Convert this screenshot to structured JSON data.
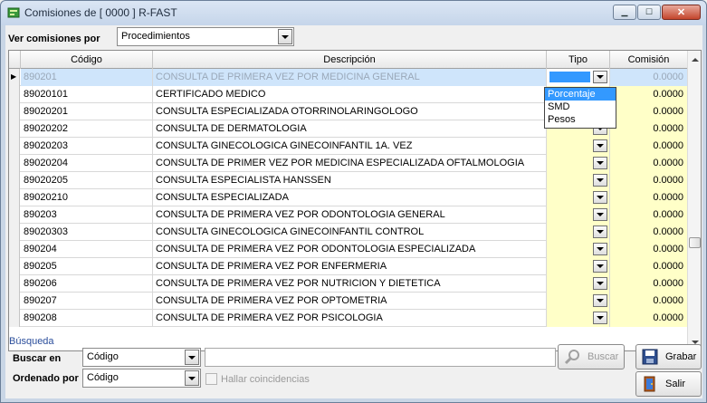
{
  "window": {
    "title": "Comisiones de [ 0000 ] R-FAST"
  },
  "filter": {
    "label": "Ver comisiones por",
    "value": "Procedimientos"
  },
  "grid": {
    "columns": {
      "codigo": "Código",
      "descripcion": "Descripción",
      "tipo": "Tipo",
      "comision": "Comisión"
    },
    "rows": [
      {
        "codigo": "890201",
        "descripcion": "CONSULTA DE PRIMERA VEZ POR MEDICINA GENERAL",
        "comision": "0.0000"
      },
      {
        "codigo": "89020101",
        "descripcion": "CERTIFICADO MEDICO",
        "comision": "0.0000"
      },
      {
        "codigo": "89020201",
        "descripcion": "CONSULTA ESPECIALIZADA OTORRINOLARINGOLOGO",
        "comision": "0.0000"
      },
      {
        "codigo": "89020202",
        "descripcion": "CONSULTA DE DERMATOLOGIA",
        "comision": "0.0000"
      },
      {
        "codigo": "89020203",
        "descripcion": "CONSULTA GINECOLOGICA  GINECOINFANTIL 1A. VEZ",
        "comision": "0.0000"
      },
      {
        "codigo": "89020204",
        "descripcion": "CONSULTA DE PRIMER VEZ POR MEDICINA ESPECIALIZADA OFTALMOLOGIA",
        "comision": "0.0000"
      },
      {
        "codigo": "89020205",
        "descripcion": "CONSULTA ESPECIALISTA HANSSEN",
        "comision": "0.0000"
      },
      {
        "codigo": "89020210",
        "descripcion": "CONSULTA ESPECIALIZADA",
        "comision": "0.0000"
      },
      {
        "codigo": "890203",
        "descripcion": "CONSULTA DE PRIMERA VEZ POR ODONTOLOGIA GENERAL",
        "comision": "0.0000"
      },
      {
        "codigo": "89020303",
        "descripcion": "CONSULTA GINECOLOGICA  GINECOINFANTIL CONTROL",
        "comision": "0.0000"
      },
      {
        "codigo": "890204",
        "descripcion": "CONSULTA DE PRIMERA VEZ POR ODONTOLOGIA ESPECIALIZADA",
        "comision": "0.0000"
      },
      {
        "codigo": "890205",
        "descripcion": "CONSULTA DE PRIMERA VEZ POR ENFERMERIA",
        "comision": "0.0000"
      },
      {
        "codigo": "890206",
        "descripcion": "CONSULTA DE PRIMERA VEZ POR NUTRICION Y DIETETICA",
        "comision": "0.0000"
      },
      {
        "codigo": "890207",
        "descripcion": "CONSULTA DE PRIMERA VEZ POR OPTOMETRIA",
        "comision": "0.0000"
      },
      {
        "codigo": "890208",
        "descripcion": "CONSULTA DE PRIMERA VEZ POR PSICOLOGIA",
        "comision": "0.0000"
      }
    ]
  },
  "tipo_dropdown": {
    "options": [
      "Porcentaje",
      "SMD",
      "Pesos"
    ],
    "selected": "Porcentaje"
  },
  "search": {
    "section_title": "Búsqueda",
    "buscar_en_label": "Buscar en",
    "buscar_en_value": "Código",
    "text_value": "",
    "buscar_button": "Buscar",
    "ordenado_por_label": "Ordenado por",
    "ordenado_por_value": "Código",
    "coincidencias_label": "Hallar coincidencias"
  },
  "actions": {
    "grabar": "Grabar",
    "salir": "Salir"
  }
}
